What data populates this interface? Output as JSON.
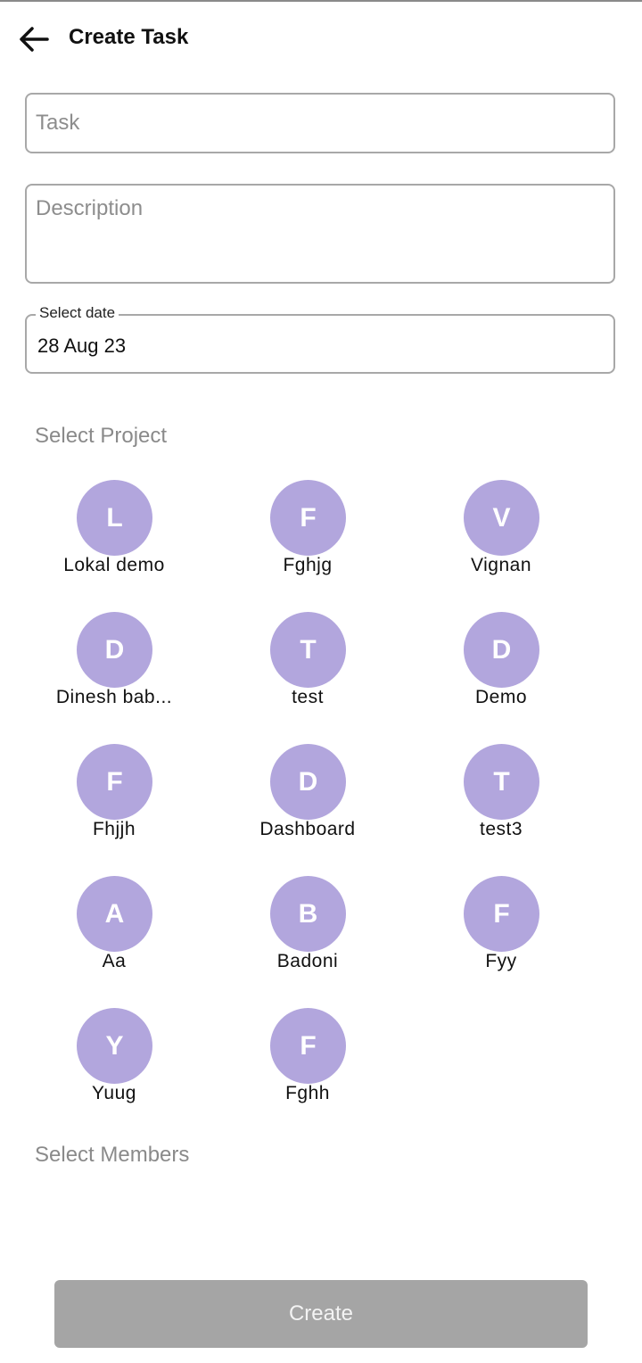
{
  "header": {
    "title": "Create Task",
    "back_icon": "arrow-left-icon"
  },
  "form": {
    "task_placeholder": "Task",
    "task_value": "",
    "description_placeholder": "Description",
    "description_value": "",
    "date_label": "Select date",
    "date_value": "28 Aug 23"
  },
  "select_project_label": "Select Project",
  "projects": [
    {
      "initial": "L",
      "name": "Lokal demo"
    },
    {
      "initial": "F",
      "name": "Fghjg"
    },
    {
      "initial": "V",
      "name": "Vignan"
    },
    {
      "initial": "D",
      "name": "Dinesh bab..."
    },
    {
      "initial": "T",
      "name": "test"
    },
    {
      "initial": "D",
      "name": "Demo"
    },
    {
      "initial": "F",
      "name": "Fhjjh"
    },
    {
      "initial": "D",
      "name": "Dashboard"
    },
    {
      "initial": "T",
      "name": "test3"
    },
    {
      "initial": "A",
      "name": "Aa"
    },
    {
      "initial": "B",
      "name": "Badoni"
    },
    {
      "initial": "F",
      "name": "Fyy"
    },
    {
      "initial": "Y",
      "name": "Yuug"
    },
    {
      "initial": "F",
      "name": "Fghh"
    }
  ],
  "select_members_label": "Select Members",
  "create_button_label": "Create",
  "colors": {
    "avatar": "#b2a6dd",
    "create_button_disabled": "#a5a5a5",
    "border": "#a8a8a8"
  }
}
